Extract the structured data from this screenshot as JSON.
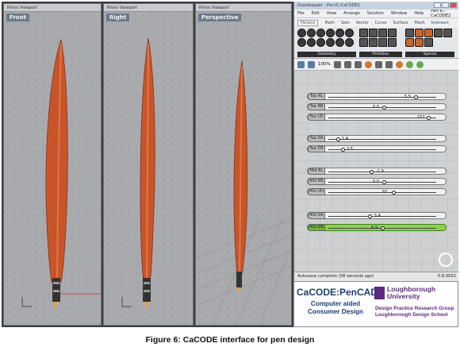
{
  "viewports": [
    {
      "window_title": "Rhino Viewport",
      "name": "Front"
    },
    {
      "window_title": "Rhino Viewport",
      "name": "Right"
    },
    {
      "window_title": "Rhino Viewport",
      "name": "Perspective"
    }
  ],
  "grasshopper": {
    "window_title": "Grasshopper - Pen-IC-CaCODE2",
    "menu": [
      "File",
      "Edit",
      "View",
      "Arrange",
      "Solution",
      "Window",
      "Help",
      "Pen-IC-CaCODE2"
    ],
    "tabs": [
      "Params",
      "Math",
      "Sets",
      "Vector",
      "Curve",
      "Surface",
      "Mesh",
      "Intersect"
    ],
    "active_tab": "Params",
    "ribbon_groups": [
      "Geometry",
      "Primitive",
      "Special"
    ],
    "zoom": "100%",
    "sliders": [
      {
        "label": "Top RL",
        "value": "5.5",
        "position": 0.82
      },
      {
        "label": "Top RB",
        "value": "0.0",
        "position": 0.5
      },
      {
        "label": "Top UD",
        "value": "157",
        "position": 0.9
      },
      {
        "label": "Top DA",
        "value": "1.4",
        "position": 0.12
      },
      {
        "label": "Top DB",
        "value": "2.5",
        "position": 0.12
      },
      {
        "label": "Mid RL",
        "value": "-1.9",
        "position": 0.5
      },
      {
        "label": "Mid RB",
        "value": "0.0",
        "position": 0.5
      },
      {
        "label": "Mid UD",
        "value": "87",
        "position": 0.6
      },
      {
        "label": "Mid DA",
        "value": "5.4",
        "position": 0.5
      },
      {
        "label": "Mid DB",
        "value": "6.9",
        "position": 0.5,
        "active": true
      }
    ],
    "status": "Autosave complete (58 seconds ago)",
    "version": "0.8.0052"
  },
  "logo": {
    "pencad_title": "CaCODE:PenCAD",
    "pencad_subtitle": "Computer aided Consumer Design",
    "university_line1": "Loughborough",
    "university_line2": "University",
    "group_line1": "Design Practice Research Group",
    "group_line2": "Loughborough Design School"
  },
  "caption": "Figure 6: CaCODE interface for pen design",
  "colors": {
    "pen_body": "#c8552a",
    "accent_purple": "#5b2a7e",
    "pencad_blue": "#1a3f73",
    "active_slider": "#8fd14f"
  }
}
